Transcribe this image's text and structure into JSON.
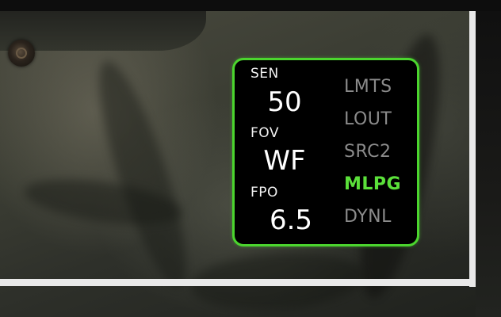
{
  "hud": {
    "fields": [
      {
        "label": "SEN",
        "value": "50"
      },
      {
        "label": "FOV",
        "value": "WF"
      },
      {
        "label": "FPO",
        "value": "6.5"
      }
    ],
    "modes": [
      {
        "label": "LMTS",
        "active": false
      },
      {
        "label": "LOUT",
        "active": false
      },
      {
        "label": "SRC2",
        "active": false
      },
      {
        "label": "MLPG",
        "active": true
      },
      {
        "label": "DYNL",
        "active": false
      }
    ],
    "colors": {
      "accent": "#4bd52e",
      "active_mode": "#5be03a",
      "inactive_mode": "#8b8b8b",
      "value_text": "#ffffff"
    }
  }
}
